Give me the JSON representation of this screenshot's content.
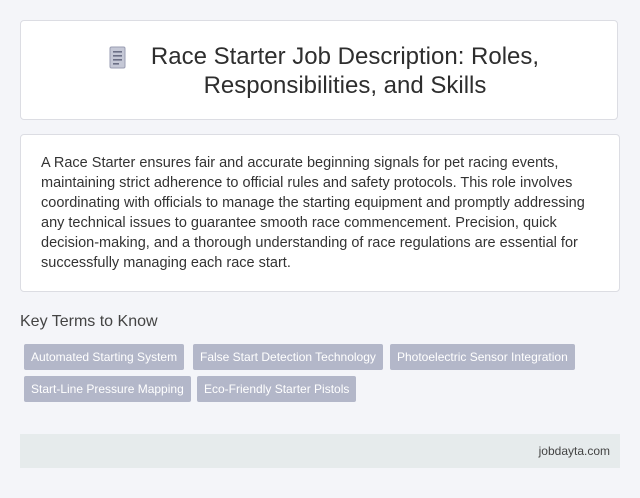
{
  "header": {
    "icon": "document-icon",
    "title": "Race Starter Job Description: Roles, Responsibilities, and Skills"
  },
  "description": {
    "text": "A Race Starter ensures fair and accurate beginning signals for pet racing events, maintaining strict adherence to official rules and safety protocols. This role involves coordinating with officials to manage the starting equipment and promptly addressing any technical issues to guarantee smooth race commencement. Precision, quick decision-making, and a thorough understanding of race regulations are essential for successfully managing each race start."
  },
  "key_terms": {
    "heading": "Key Terms to Know",
    "tags": [
      "Automated Starting System",
      "False Start Detection Technology",
      "Photoelectric Sensor Integration",
      "Start-Line Pressure Mapping",
      "Eco-Friendly Starter Pistols"
    ]
  },
  "footer": {
    "site": "jobdayta.com"
  }
}
